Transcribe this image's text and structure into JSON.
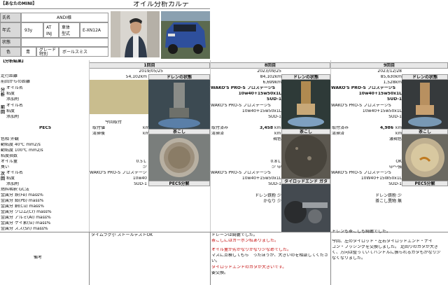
{
  "header": {
    "title": "オイル分析カルテ",
    "your_mini": "【あなたのMINI】",
    "analysis_results": "【分析結果】"
  },
  "profile": {
    "name_label": "氏名",
    "name_value": "ANDI様",
    "year_label": "年式",
    "year_value": "93y",
    "trans_label": "AT",
    "trans_sub": "INJ",
    "engine_label": "車体",
    "engine_sub": "型式",
    "model_value": "E-XN12A",
    "condition_label": "状態",
    "color_label": "色",
    "color_value": "青",
    "grade_label": "グレード",
    "grade_sub": "特別",
    "grade_value": "ボールスミス"
  },
  "left_rows": [
    "走行距離",
    "前回からの距離",
    "オイル名",
    "粘度",
    "添加剤",
    "オイル名",
    "粘度",
    "添加剤",
    "PEC5",
    "色相 外観",
    "動粘度 40℃ mm2/s",
    "動粘度 100℃ mm2/s",
    "粘度指数",
    "オイル量",
    "臭い",
    "オイル名",
    "粘度",
    "添加剤",
    "燃料稀釈 GC法",
    "金属分 鉄(Fe) mass%",
    "金属分 鉛(Pb) mass%",
    "金属分 銅(Cu) mass%",
    "金属分 クロム(Cr) mass%",
    "金属分 アルミ(Al) mass%",
    "金属分 ケイ素(Si) mass%",
    "金属分 スズ(Sn) mass%"
  ],
  "side_labels": {
    "bunseki": "分析",
    "zenkai": "前回",
    "jikai": "次回"
  },
  "columns": [
    {
      "round": "1回目",
      "date": "2019/05/25",
      "km": "54,102km",
      "diff": "",
      "oil": "",
      "visc": "",
      "add": "",
      "pec_note": "今回取付",
      "pec_a": "取付値",
      "pec_b": "清掃後",
      "unit": "km",
      "drain": "ドレンの状態",
      "chakoshi": "茶こし",
      "pec_bun": "PEC5分解",
      "color": "",
      "oil_amount": "0.5Ｌ",
      "smell": "少",
      "next_oil": "WAKO'S PRO-S プロステージ",
      "next_visc": "10w40",
      "next_add": "SUD-1",
      "notes": [
        "タイムラグ小 ストールテストOK"
      ]
    },
    {
      "round": "8回目",
      "date": "2023/09/25",
      "km": "84,102km",
      "diff": "6,699km",
      "oil": "WAKO'S PRO-S プロステージS",
      "visc": "10w40+15w50x1L",
      "add": "SUD-1",
      "prev_oil": "WAKO'S PRO-S プロステージS",
      "prev_visc": "10w40+15w50x1L",
      "prev_add": "SUD-1",
      "pec_note": "",
      "pec_a": "取付済み",
      "pec_a_val": "3,458",
      "pec_b": "清掃済",
      "unit": "km",
      "drain": "ドレンの状態",
      "chakoshi": "茶こし",
      "tierod": "タイロッドエンド ガタ",
      "color": "褐色",
      "oil_amount": "0.8Ｌ",
      "smell": "少 中",
      "next_oil": "WAKO'S PRO-S プロステージS",
      "next_visc": "10w40+15w50x1L",
      "next_add": "SUD-1",
      "notes_block": "ドレン鉄粉 少\nかなり 少",
      "notes": [
        "ドレーンは綺麗でした。",
        "茶こしにはカーボン粒ありました。",
        "",
        "オイル量が劣かなりかなり少なめでした。",
        "マスに点検してもら　ったほうが、大きいのを相談してくださ",
        "い。",
        "",
        "タイロッドエンドのガタが大きいです。",
        "要交換。"
      ]
    },
    {
      "round": "9回目",
      "date": "2023/12/28",
      "km": "85,630km",
      "diff": "1,528km",
      "oil": "WAKO'S PRO-S プロステージS",
      "visc": "10w40+15w50x1L",
      "add": "SUD-1",
      "prev_oil": "WAKO'S PRO-S プロステージS",
      "prev_visc": "10w40+15w50x1L",
      "prev_add": "SUD-1",
      "pec_note": "",
      "pec_a": "取付済み",
      "pec_a_val": "4,986",
      "pec_b": "清掃済",
      "unit": "km",
      "drain": "ドレンの状態",
      "chakoshi": "茶こし",
      "pec_bun": "PEC5分解",
      "color": "濃褐色",
      "oil_amount": "OK",
      "smell": "中〜強",
      "next_oil": "WAKO'S PRO-S プロステージS",
      "next_visc": "10W40+15W50x1L",
      "next_add": "SUD-1",
      "notes_block": "ドレン鉄粉 少\n茶こし異物 無",
      "notes": [
        "ドレンも茶こしも綺麗でした。",
        "",
        "今回、左のタイロッド・左右タイロッドエンド・ナイ",
        "コン・ブッシングを交換しました。 足回りのガタが大き",
        "く、方向は整っていてハンドルに振られるガタもかなり少",
        "なくなりました。"
      ]
    }
  ],
  "remarks_label": "備考"
}
